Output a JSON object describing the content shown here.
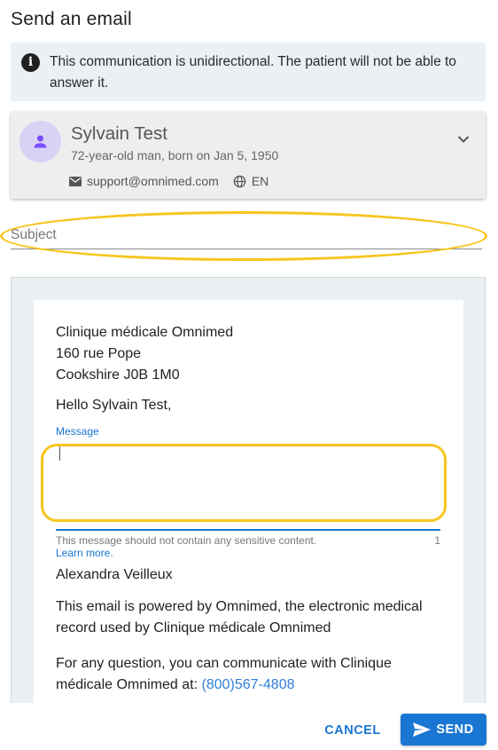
{
  "dialog": {
    "title": "Send an email"
  },
  "info": {
    "text": "This communication is unidirectional. The patient will not be able to answer it."
  },
  "patient": {
    "name": "Sylvain Test",
    "description": "72-year-old man, born on Jan 5, 1950",
    "email": "support@omnimed.com",
    "language": "EN"
  },
  "subject": {
    "placeholder": "Subject",
    "value": ""
  },
  "email": {
    "clinic_name": "Clinique médicale Omnimed",
    "address_line": "160 rue Pope",
    "city_line": "Cookshire J0B 1M0",
    "greeting": "Hello Sylvain Test,",
    "message_label": "Message",
    "helper_text": "This message should not contain any sensitive content.",
    "char_count": "1",
    "learn_more": "Learn more.",
    "signature": "Alexandra Veilleux",
    "powered_by": "This email is powered by Omnimed, the electronic medical record used by Clinique médicale Omnimed",
    "contact_prefix": "For any question, you can communicate with Clinique médicale Omnimed at:",
    "phone": "(800)567-4808"
  },
  "actions": {
    "cancel": "CANCEL",
    "send": "SEND"
  },
  "colors": {
    "accent": "#1976d2",
    "highlight": "#f7c51e",
    "avatar_bg": "#d9d2f5",
    "avatar_fg": "#7c4dff"
  }
}
